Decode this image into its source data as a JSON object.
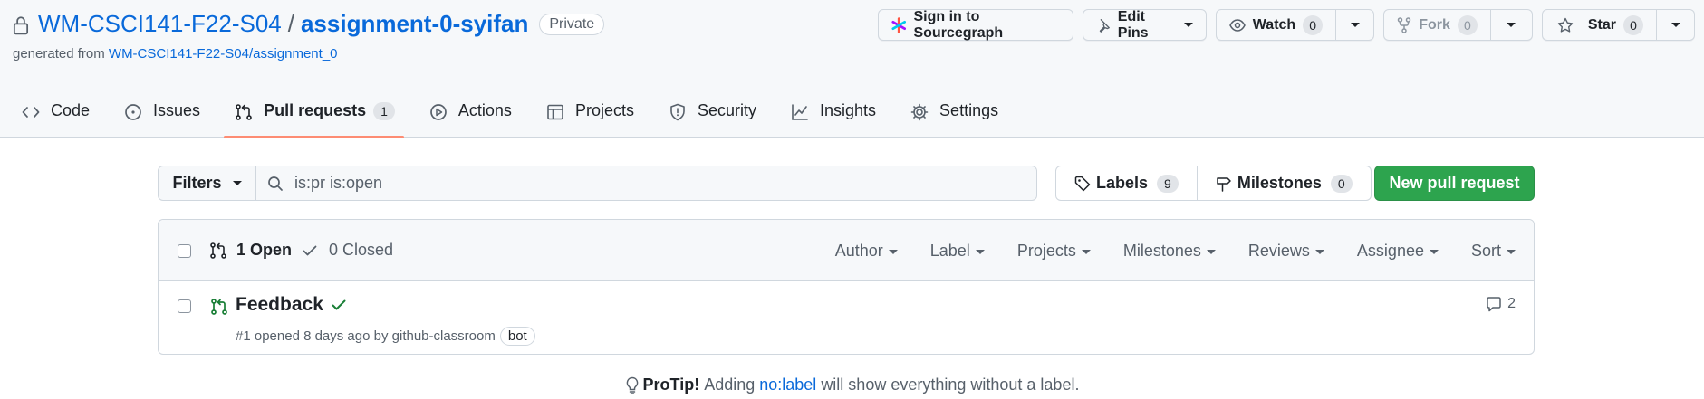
{
  "repo": {
    "owner": "WM-CSCI141-F22-S04",
    "separator": "/",
    "name": "assignment-0-syifan",
    "visibility": "Private",
    "generated_prefix": "generated from",
    "template": "WM-CSCI141-F22-S04/assignment_0"
  },
  "header_actions": {
    "sourcegraph": "Sign in to Sourcegraph",
    "edit_pins": "Edit Pins",
    "watch": "Watch",
    "watch_count": "0",
    "fork": "Fork",
    "fork_count": "0",
    "star": "Star",
    "star_count": "0"
  },
  "tabs": [
    {
      "label": "Code",
      "icon": "code-icon"
    },
    {
      "label": "Issues",
      "icon": "issue-opened-icon"
    },
    {
      "label": "Pull requests",
      "icon": "git-pull-request-icon",
      "count": "1",
      "selected": true
    },
    {
      "label": "Actions",
      "icon": "play-icon"
    },
    {
      "label": "Projects",
      "icon": "table-icon"
    },
    {
      "label": "Security",
      "icon": "shield-icon"
    },
    {
      "label": "Insights",
      "icon": "graph-icon"
    },
    {
      "label": "Settings",
      "icon": "gear-icon"
    }
  ],
  "toolbar": {
    "filters_label": "Filters",
    "search_value": "is:pr is:open",
    "labels_label": "Labels",
    "labels_count": "9",
    "milestones_label": "Milestones",
    "milestones_count": "0",
    "new_pr_label": "New pull request"
  },
  "list": {
    "open_label": "1 Open",
    "closed_label": "0 Closed",
    "filters": [
      "Author",
      "Label",
      "Projects",
      "Milestones",
      "Reviews",
      "Assignee",
      "Sort"
    ],
    "items": [
      {
        "title": "Feedback",
        "status": "check-passed",
        "meta": "#1 opened 8 days ago by github-classroom",
        "badge": "bot",
        "comments": "2"
      }
    ]
  },
  "protip": {
    "label": "ProTip!",
    "before": "Adding",
    "link": "no:label",
    "after": "will show everything without a label."
  },
  "colors": {
    "link": "#0969da",
    "primary_button": "#2da44e",
    "selected_tab_underline": "#fd8c73",
    "open_icon": "#1a7f37"
  }
}
